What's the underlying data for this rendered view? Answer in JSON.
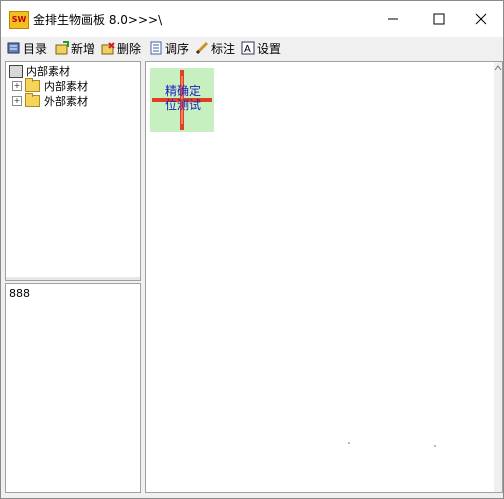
{
  "window": {
    "app_icon_text": "SW",
    "title": "金排生物画板 8.0>>>\\",
    "controls": [
      "minimize-icon",
      "maximize-icon",
      "close-icon"
    ]
  },
  "toolbar": {
    "items": [
      {
        "label": "目录",
        "icon": "catalog-icon"
      },
      {
        "label": "新增",
        "icon": "add-icon"
      },
      {
        "label": "删除",
        "icon": "delete-icon"
      },
      {
        "label": "调序",
        "icon": "reorder-icon"
      },
      {
        "label": "标注",
        "icon": "pencil-icon"
      },
      {
        "label": "设置",
        "icon": "settings-icon"
      }
    ]
  },
  "tree": {
    "root": "内部素材",
    "children": [
      "内部素材",
      "外部素材"
    ]
  },
  "memo": {
    "text": "888"
  },
  "canvas": {
    "item_label": "精确定位测试",
    "item_label_line1": "精确定",
    "item_label_line2": "位测试"
  },
  "colors": {
    "thumb_bg": "#c6f0c0",
    "crosshair": "#e04020",
    "label": "#2020c0"
  }
}
